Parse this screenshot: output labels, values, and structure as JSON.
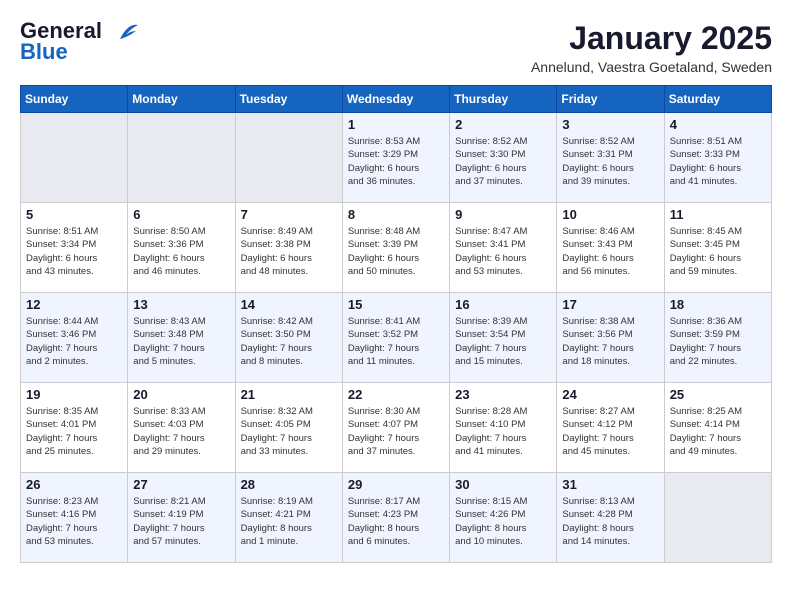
{
  "logo": {
    "line1": "General",
    "line2": "Blue"
  },
  "title": "January 2025",
  "location": "Annelund, Vaestra Goetaland, Sweden",
  "weekdays": [
    "Sunday",
    "Monday",
    "Tuesday",
    "Wednesday",
    "Thursday",
    "Friday",
    "Saturday"
  ],
  "weeks": [
    [
      {
        "day": "",
        "info": ""
      },
      {
        "day": "",
        "info": ""
      },
      {
        "day": "",
        "info": ""
      },
      {
        "day": "1",
        "info": "Sunrise: 8:53 AM\nSunset: 3:29 PM\nDaylight: 6 hours\nand 36 minutes."
      },
      {
        "day": "2",
        "info": "Sunrise: 8:52 AM\nSunset: 3:30 PM\nDaylight: 6 hours\nand 37 minutes."
      },
      {
        "day": "3",
        "info": "Sunrise: 8:52 AM\nSunset: 3:31 PM\nDaylight: 6 hours\nand 39 minutes."
      },
      {
        "day": "4",
        "info": "Sunrise: 8:51 AM\nSunset: 3:33 PM\nDaylight: 6 hours\nand 41 minutes."
      }
    ],
    [
      {
        "day": "5",
        "info": "Sunrise: 8:51 AM\nSunset: 3:34 PM\nDaylight: 6 hours\nand 43 minutes."
      },
      {
        "day": "6",
        "info": "Sunrise: 8:50 AM\nSunset: 3:36 PM\nDaylight: 6 hours\nand 46 minutes."
      },
      {
        "day": "7",
        "info": "Sunrise: 8:49 AM\nSunset: 3:38 PM\nDaylight: 6 hours\nand 48 minutes."
      },
      {
        "day": "8",
        "info": "Sunrise: 8:48 AM\nSunset: 3:39 PM\nDaylight: 6 hours\nand 50 minutes."
      },
      {
        "day": "9",
        "info": "Sunrise: 8:47 AM\nSunset: 3:41 PM\nDaylight: 6 hours\nand 53 minutes."
      },
      {
        "day": "10",
        "info": "Sunrise: 8:46 AM\nSunset: 3:43 PM\nDaylight: 6 hours\nand 56 minutes."
      },
      {
        "day": "11",
        "info": "Sunrise: 8:45 AM\nSunset: 3:45 PM\nDaylight: 6 hours\nand 59 minutes."
      }
    ],
    [
      {
        "day": "12",
        "info": "Sunrise: 8:44 AM\nSunset: 3:46 PM\nDaylight: 7 hours\nand 2 minutes."
      },
      {
        "day": "13",
        "info": "Sunrise: 8:43 AM\nSunset: 3:48 PM\nDaylight: 7 hours\nand 5 minutes."
      },
      {
        "day": "14",
        "info": "Sunrise: 8:42 AM\nSunset: 3:50 PM\nDaylight: 7 hours\nand 8 minutes."
      },
      {
        "day": "15",
        "info": "Sunrise: 8:41 AM\nSunset: 3:52 PM\nDaylight: 7 hours\nand 11 minutes."
      },
      {
        "day": "16",
        "info": "Sunrise: 8:39 AM\nSunset: 3:54 PM\nDaylight: 7 hours\nand 15 minutes."
      },
      {
        "day": "17",
        "info": "Sunrise: 8:38 AM\nSunset: 3:56 PM\nDaylight: 7 hours\nand 18 minutes."
      },
      {
        "day": "18",
        "info": "Sunrise: 8:36 AM\nSunset: 3:59 PM\nDaylight: 7 hours\nand 22 minutes."
      }
    ],
    [
      {
        "day": "19",
        "info": "Sunrise: 8:35 AM\nSunset: 4:01 PM\nDaylight: 7 hours\nand 25 minutes."
      },
      {
        "day": "20",
        "info": "Sunrise: 8:33 AM\nSunset: 4:03 PM\nDaylight: 7 hours\nand 29 minutes."
      },
      {
        "day": "21",
        "info": "Sunrise: 8:32 AM\nSunset: 4:05 PM\nDaylight: 7 hours\nand 33 minutes."
      },
      {
        "day": "22",
        "info": "Sunrise: 8:30 AM\nSunset: 4:07 PM\nDaylight: 7 hours\nand 37 minutes."
      },
      {
        "day": "23",
        "info": "Sunrise: 8:28 AM\nSunset: 4:10 PM\nDaylight: 7 hours\nand 41 minutes."
      },
      {
        "day": "24",
        "info": "Sunrise: 8:27 AM\nSunset: 4:12 PM\nDaylight: 7 hours\nand 45 minutes."
      },
      {
        "day": "25",
        "info": "Sunrise: 8:25 AM\nSunset: 4:14 PM\nDaylight: 7 hours\nand 49 minutes."
      }
    ],
    [
      {
        "day": "26",
        "info": "Sunrise: 8:23 AM\nSunset: 4:16 PM\nDaylight: 7 hours\nand 53 minutes."
      },
      {
        "day": "27",
        "info": "Sunrise: 8:21 AM\nSunset: 4:19 PM\nDaylight: 7 hours\nand 57 minutes."
      },
      {
        "day": "28",
        "info": "Sunrise: 8:19 AM\nSunset: 4:21 PM\nDaylight: 8 hours\nand 1 minute."
      },
      {
        "day": "29",
        "info": "Sunrise: 8:17 AM\nSunset: 4:23 PM\nDaylight: 8 hours\nand 6 minutes."
      },
      {
        "day": "30",
        "info": "Sunrise: 8:15 AM\nSunset: 4:26 PM\nDaylight: 8 hours\nand 10 minutes."
      },
      {
        "day": "31",
        "info": "Sunrise: 8:13 AM\nSunset: 4:28 PM\nDaylight: 8 hours\nand 14 minutes."
      },
      {
        "day": "",
        "info": ""
      }
    ]
  ]
}
